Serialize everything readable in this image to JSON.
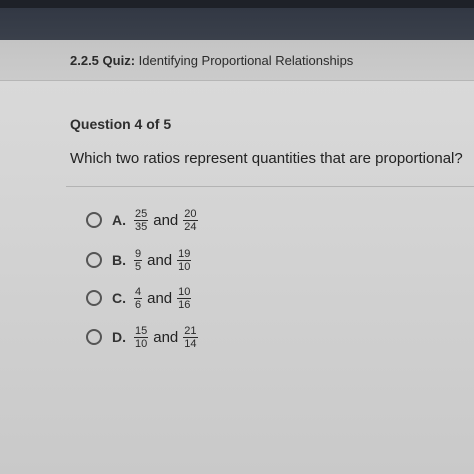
{
  "quiz": {
    "code": "2.2.5",
    "type": "Quiz:",
    "title": "Identifying Proportional Relationships"
  },
  "question": {
    "number_label": "Question 4 of 5",
    "text": "Which two ratios represent quantities that are proportional?"
  },
  "options": [
    {
      "letter": "A.",
      "a_num": "25",
      "a_den": "35",
      "and": "and",
      "b_num": "20",
      "b_den": "24"
    },
    {
      "letter": "B.",
      "a_num": "9",
      "a_den": "5",
      "and": "and",
      "b_num": "19",
      "b_den": "10"
    },
    {
      "letter": "C.",
      "a_num": "4",
      "a_den": "6",
      "and": "and",
      "b_num": "10",
      "b_den": "16"
    },
    {
      "letter": "D.",
      "a_num": "15",
      "a_den": "10",
      "and": "and",
      "b_num": "21",
      "b_den": "14"
    }
  ]
}
